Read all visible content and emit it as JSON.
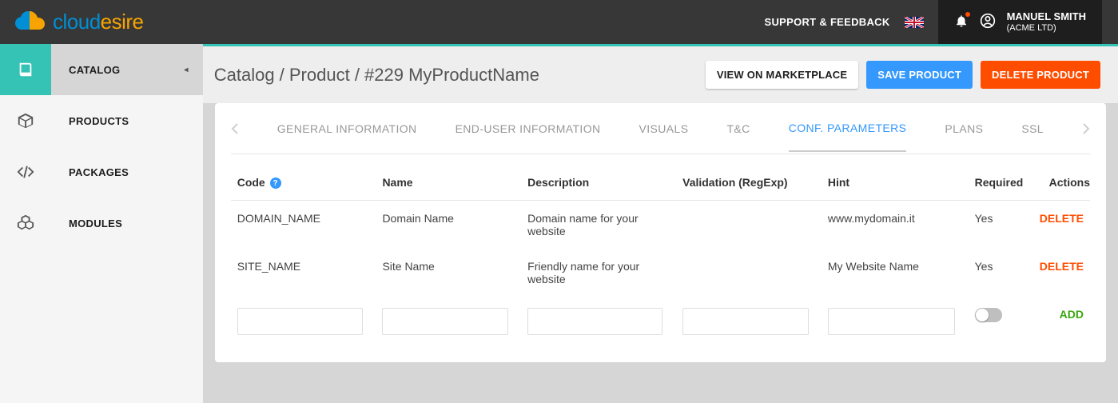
{
  "header": {
    "logo_prefix": "cloud",
    "logo_suffix": "esire",
    "support_label": "SUPPORT & FEEDBACK",
    "user_name": "MANUEL SMITH",
    "user_company": "(ACME LTD)"
  },
  "sidebar": {
    "items": [
      {
        "label": "CATALOG"
      },
      {
        "label": "PRODUCTS"
      },
      {
        "label": "PACKAGES"
      },
      {
        "label": "MODULES"
      }
    ]
  },
  "breadcrumb": "Catalog / Product / #229 MyProductName",
  "actions": {
    "view_marketplace": "VIEW ON MARKETPLACE",
    "save_product": "SAVE PRODUCT",
    "delete_product": "DELETE PRODUCT"
  },
  "tabs": [
    "GENERAL INFORMATION",
    "END-USER INFORMATION",
    "VISUALS",
    "T&C",
    "CONF. PARAMETERS",
    "PLANS",
    "SSL"
  ],
  "table": {
    "headers": {
      "code": "Code",
      "name": "Name",
      "description": "Description",
      "validation": "Validation (RegExp)",
      "hint": "Hint",
      "required": "Required",
      "actions": "Actions"
    },
    "rows": [
      {
        "code": "DOMAIN_NAME",
        "name": "Domain Name",
        "description": "Domain name for your website",
        "validation": "",
        "hint": "www.mydomain.it",
        "required": "Yes"
      },
      {
        "code": "SITE_NAME",
        "name": "Site Name",
        "description": "Friendly name for your website",
        "validation": "",
        "hint": "My Website Name",
        "required": "Yes"
      }
    ],
    "row_actions": {
      "delete": "DELETE",
      "add": "ADD"
    }
  }
}
